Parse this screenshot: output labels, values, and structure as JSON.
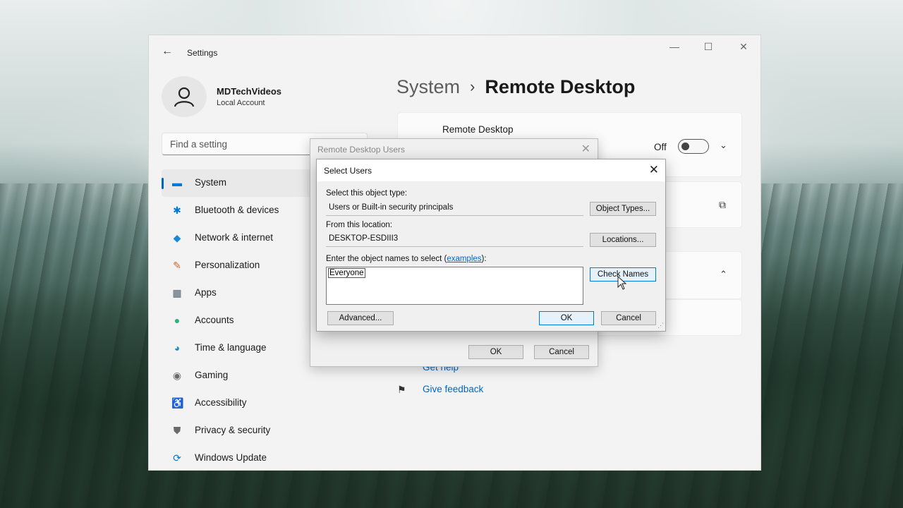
{
  "settings": {
    "app_title": "Settings",
    "window_controls": {
      "minimize": "—",
      "maximize": "☐",
      "close": "✕"
    },
    "profile": {
      "name": "MDTechVideos",
      "account_type": "Local Account"
    },
    "search": {
      "placeholder": "Find a setting"
    },
    "nav": [
      {
        "label": "System",
        "icon": "monitor-icon",
        "glyph": "▬",
        "color": "#0078d4",
        "active": true
      },
      {
        "label": "Bluetooth & devices",
        "icon": "bluetooth-icon",
        "glyph": "✱",
        "color": "#0078d4",
        "active": false
      },
      {
        "label": "Network & internet",
        "icon": "wifi-icon",
        "glyph": "◆",
        "color": "#1a88d6",
        "active": false
      },
      {
        "label": "Personalization",
        "icon": "brush-icon",
        "glyph": "✎",
        "color": "#c46a2a",
        "active": false
      },
      {
        "label": "Apps",
        "icon": "apps-icon",
        "glyph": "▦",
        "color": "#4a5a6a",
        "active": false
      },
      {
        "label": "Accounts",
        "icon": "person-icon",
        "glyph": "●",
        "color": "#2fae7a",
        "active": false
      },
      {
        "label": "Time & language",
        "icon": "globe-clock-icon",
        "glyph": "◕",
        "color": "#1e90c8",
        "active": false
      },
      {
        "label": "Gaming",
        "icon": "gamepad-icon",
        "glyph": "◉",
        "color": "#6b6b6b",
        "active": false
      },
      {
        "label": "Accessibility",
        "icon": "accessibility-icon",
        "glyph": "♿",
        "color": "#1f6fc4",
        "active": false
      },
      {
        "label": "Privacy & security",
        "icon": "shield-icon",
        "glyph": "⛊",
        "color": "#6a6a6a",
        "active": false
      },
      {
        "label": "Windows Update",
        "icon": "update-icon",
        "glyph": "⟳",
        "color": "#0078d4",
        "active": false
      }
    ],
    "breadcrumb": {
      "parent": "System",
      "separator": "›",
      "current": "Remote Desktop"
    },
    "remote_desktop_card": {
      "title": "Remote Desktop",
      "state_label": "Off"
    },
    "help": {
      "get_help": "Get help",
      "give_feedback": "Give feedback"
    }
  },
  "remote_desktop_users_dialog": {
    "title": "Remote Desktop Users",
    "ok_label": "OK",
    "cancel_label": "Cancel"
  },
  "select_users_dialog": {
    "title": "Select Users",
    "object_type_label": "Select this object type:",
    "object_type_value": "Users or Built-in security principals",
    "object_types_button": "Object Types...",
    "location_label": "From this location:",
    "location_value": "DESKTOP-ESDIII3",
    "locations_button": "Locations...",
    "names_label_prefix": "Enter the object names to select (",
    "names_label_link": "examples",
    "names_label_suffix": "):",
    "names_value": "Everyone",
    "check_names_button": "Check Names",
    "advanced_button": "Advanced...",
    "ok_label": "OK",
    "cancel_label": "Cancel"
  },
  "colors": {
    "accent": "#0067c0",
    "link": "#0066cc"
  }
}
